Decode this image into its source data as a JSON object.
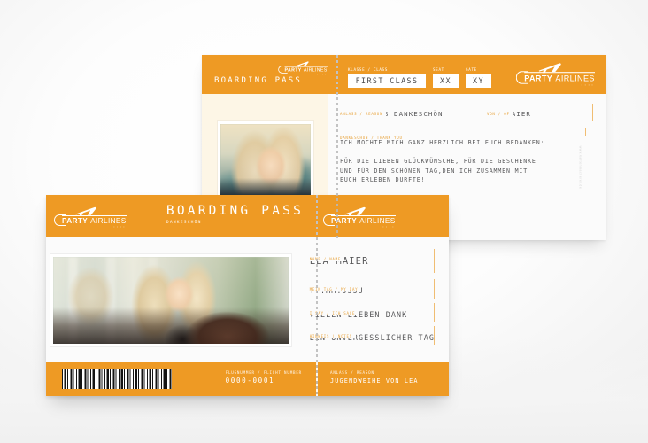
{
  "theme": {
    "orange": "#ee9a24",
    "label_orange": "#e8a33c",
    "text_gray": "#58585a",
    "paper": "#ffffff",
    "cream": "#fdf6e6"
  },
  "brand": {
    "name_bold": "PARTY",
    "name_light": "AIRLINES",
    "dots": "::::",
    "plane_icon": "airplane-icon"
  },
  "back_card": {
    "title": "BOARDING PASS",
    "stub": {
      "klasse": {
        "label": "KLASSE / CLASS",
        "value": "FIRST CLASS"
      },
      "seat": {
        "label": "SEAT",
        "value": "XX"
      },
      "gate": {
        "label": "GATE",
        "value": "XY"
      }
    },
    "fields": {
      "anlass": {
        "label": "ANLASS / REASON",
        "value": "HERZLICHES DANKESCHÖN"
      },
      "von": {
        "label": "VON / OF",
        "value": "LEA MAIER"
      },
      "danke": {
        "label": "DANKESCHÖN / THANK YOU"
      }
    },
    "body_text": "ICH MÖCHTE MICH GANZ HERZLICH BEI EUCH BEDANKEN:\n\nFÜR DIE LIEBEN GLÜCKWÜNSCHE, FÜR DIE GESCHENKE\nUND FÜR DEN SCHÖNEN TAG,DEN ICH ZUSAMMEN MIT\nEUCH ERLEBEN DURFTE!\n\nEURE LEA",
    "watermark": "www.kartenmacherei.de",
    "photo": {
      "name": "portrait-photo-blonde-woman",
      "alt": "Smiling blonde woman portrait"
    }
  },
  "front_card": {
    "title": "BOARDING PASS",
    "subtitle": "DANKESCHÖN",
    "photo": {
      "name": "wide-photo-blonde-woman",
      "alt": "Blonde woman smiling with window reflection"
    },
    "fields": [
      {
        "label": "NAME / NAME",
        "value": "LEA MAIER"
      },
      {
        "label": "MEIN TAG / MY DAY",
        "value": "TT.MM.JJJJ"
      },
      {
        "label": "I SAY / ICH SAGE",
        "value": "VIELEN LIEBEN DANK"
      },
      {
        "label": "HINWEIS | NOTES",
        "value": "EIN UNVERGESSLICHER TAG"
      }
    ],
    "footer": {
      "barcode": "barcode-icon",
      "flight": {
        "label": "FLUGNUMMER / FLIGHT NUMBER",
        "value": "0000-0001"
      },
      "anlass": {
        "label": "ANLASS / REASON",
        "value": "JUGENDWEIHE VON LEA"
      }
    }
  }
}
